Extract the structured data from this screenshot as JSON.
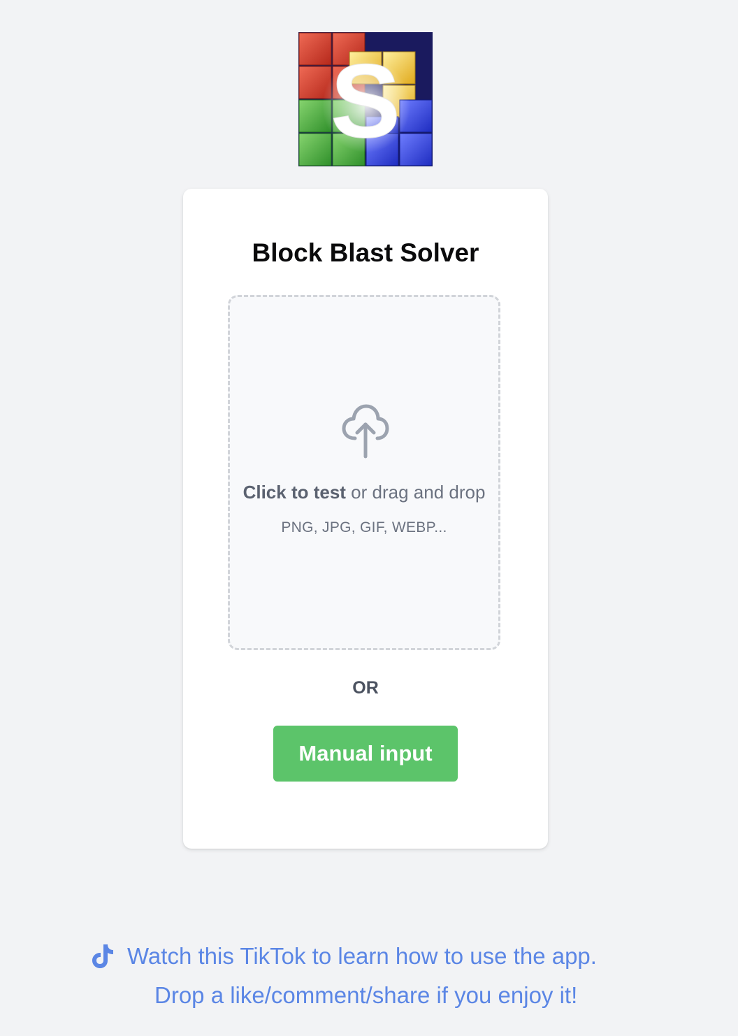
{
  "logo": {
    "letter": "S",
    "colors": {
      "red": "#d13b2a",
      "yellow": "#f2c230",
      "green": "#4cae3f",
      "blue": "#2f3fe0",
      "navy": "#1a1a5e"
    }
  },
  "card": {
    "title": "Block Blast Solver",
    "dropzone": {
      "icon": "cloud-upload-icon",
      "cta_strong": "Click to test",
      "cta_rest": " or drag and drop",
      "formats": "PNG, JPG, GIF, WEBP..."
    },
    "or_label": "OR",
    "manual_button": "Manual input"
  },
  "footer": {
    "icon": "tiktok-icon",
    "line1": "Watch this TikTok to learn how to use the app.",
    "line2": "Drop a like/comment/share if you enjoy it!"
  },
  "colors": {
    "background": "#f2f3f5",
    "button": "#5cc46a",
    "link": "#5b86e5",
    "dropzone_border": "#d1d4d9"
  }
}
